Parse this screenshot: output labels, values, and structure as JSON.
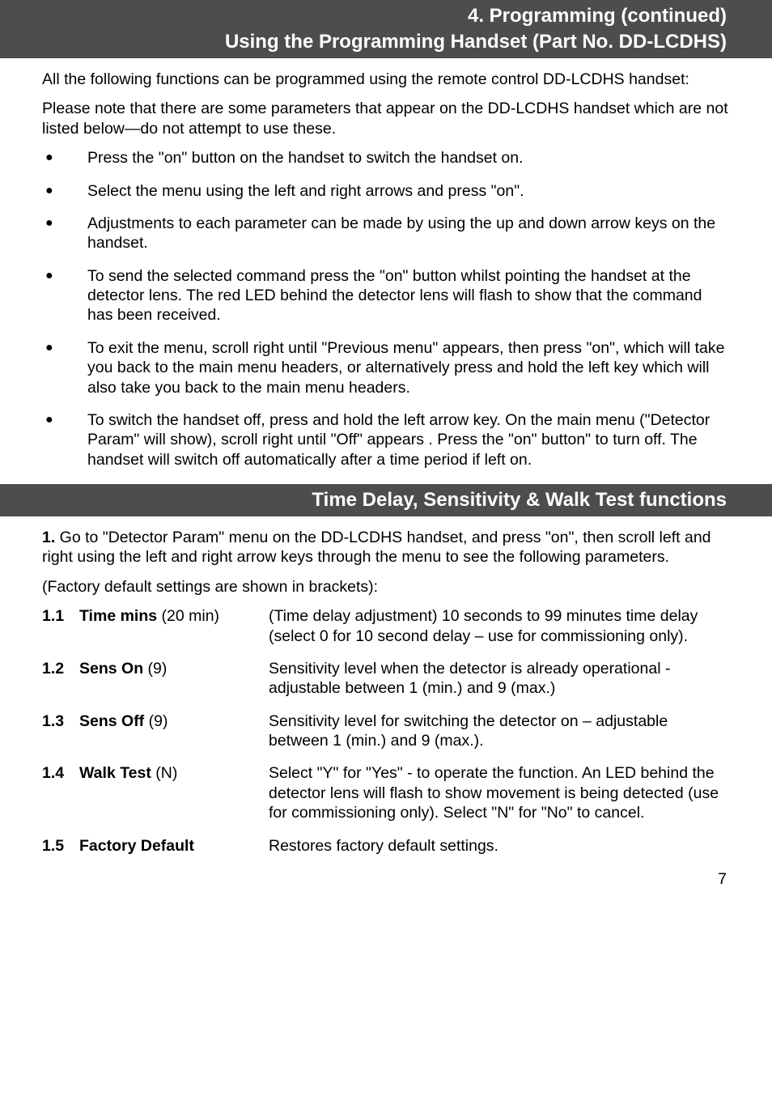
{
  "header": {
    "line1": "4. Programming (continued)",
    "line2": "Using the Programming Handset (Part No. DD-LCDHS)"
  },
  "intro1": "All the following functions can be programmed using the remote control DD-LCDHS handset:",
  "intro2": "Please note that there are some parameters that appear on the DD-LCDHS handset which are not listed below—do not attempt to use these.",
  "bullets": [
    "Press the \"on\" button on the handset to switch the handset on.",
    "Select the menu using the left and right arrows and press \"on\".",
    "Adjustments to each parameter can be made by using the up and down arrow keys on the handset.",
    "To send the selected command press the \"on\" button whilst pointing the handset at the detector lens. The red LED behind the detector lens will flash to show that the command has been received.",
    "To exit the menu, scroll right until \"Previous menu\" appears, then press \"on\", which will take you back to the main menu headers, or alternatively press and hold the left key which will also take you back to the main menu headers.",
    "To switch the handset off, press and hold the left arrow key. On the main menu (\"Detector Param\" will show), scroll right until \"Off\" appears . Press the \"on\" button\" to turn off. The handset will switch off automatically after a time period if left on."
  ],
  "subheader": "Time Delay, Sensitivity & Walk Test functions",
  "step1": "1. Go to \"Detector Param\" menu on the DD-LCDHS handset, and press \"on\", then scroll left and right using the left and right arrow keys through the menu to see the following parameters.",
  "defaults_note": " (Factory default settings are shown in brackets):",
  "params": [
    {
      "num": "1.1",
      "name_bold": "Time mins",
      "name_extra": " (20 min)",
      "desc": "(Time delay adjustment) 10 seconds to 99 minutes time delay (select 0 for 10 second delay – use for commissioning only)."
    },
    {
      "num": "1.2",
      "name_bold": "Sens On",
      "name_extra": " (9)",
      "desc": "Sensitivity level when the detector is already operational - adjustable between 1 (min.) and 9 (max.)"
    },
    {
      "num": "1.3",
      "name_bold": "Sens Off",
      "name_extra": " (9)",
      "desc": "Sensitivity level for switching the detector on – adjustable between 1 (min.) and 9 (max.)."
    },
    {
      "num": "1.4",
      "name_bold": "Walk Test",
      "name_extra": " (N)",
      "desc": "Select \"Y\" for \"Yes\" - to operate the function. An LED behind the detector lens will flash to show movement is being detected (use for commissioning only).  Select \"N\" for \"No\" to cancel."
    },
    {
      "num": "1.5",
      "name_bold": "Factory Default",
      "name_extra": "",
      "desc": "Restores factory default settings."
    }
  ],
  "page_number": "7"
}
